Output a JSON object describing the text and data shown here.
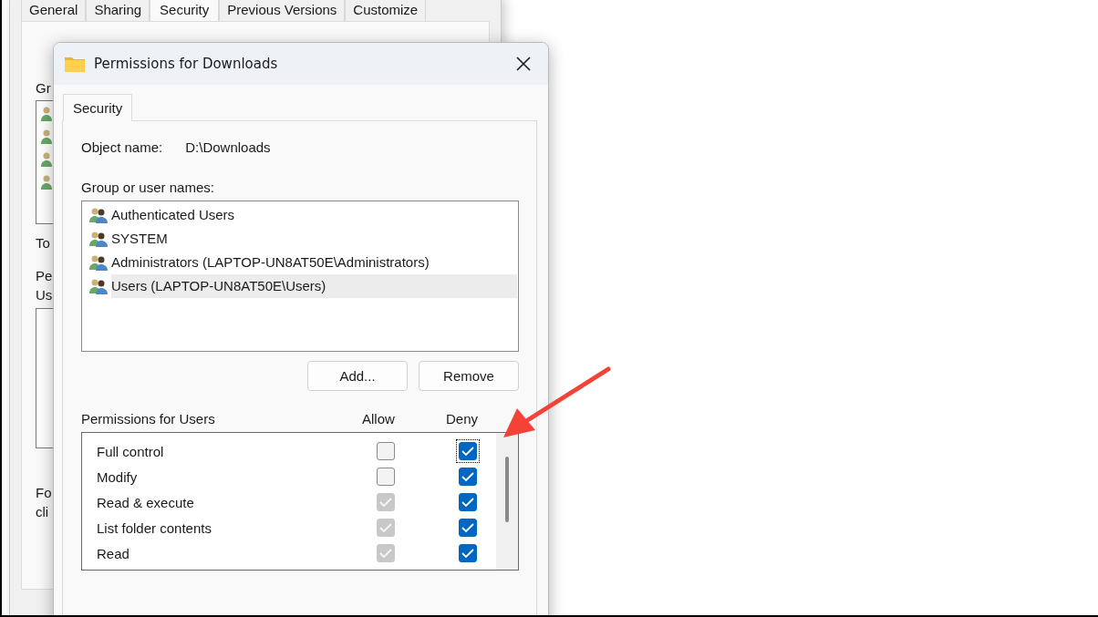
{
  "background_window": {
    "tabs": [
      {
        "label": "General",
        "selected": false
      },
      {
        "label": "Sharing",
        "selected": false
      },
      {
        "label": "Security",
        "selected": true
      },
      {
        "label": "Previous Versions",
        "selected": false
      },
      {
        "label": "Customize",
        "selected": false
      }
    ],
    "cut_labels": [
      "Gr",
      "To",
      "Pe",
      "Us",
      "Fo",
      "cli"
    ]
  },
  "dialog": {
    "title": "Permissions for Downloads",
    "tabs": [
      {
        "label": "Security",
        "selected": true
      }
    ],
    "object_name_label": "Object name:",
    "object_name": "D:\\Downloads",
    "group_label": "Group or user names:",
    "users": [
      {
        "name": "Authenticated Users",
        "selected": false
      },
      {
        "name": "SYSTEM",
        "selected": false
      },
      {
        "name": "Administrators (LAPTOP-UN8AT50E\\Administrators)",
        "selected": false
      },
      {
        "name": "Users (LAPTOP-UN8AT50E\\Users)",
        "selected": true
      }
    ],
    "buttons": [
      "Add...",
      "Remove"
    ],
    "permissions_label": "Permissions for Users",
    "allow_label": "Allow",
    "deny_label": "Deny",
    "permissions": [
      {
        "name": "Full control",
        "allow": false,
        "allow_disabled": false,
        "deny": true,
        "focused": true
      },
      {
        "name": "Modify",
        "allow": false,
        "allow_disabled": false,
        "deny": true,
        "focused": false
      },
      {
        "name": "Read & execute",
        "allow": true,
        "allow_disabled": true,
        "deny": true,
        "focused": false
      },
      {
        "name": "List folder contents",
        "allow": true,
        "allow_disabled": true,
        "deny": true,
        "focused": false
      },
      {
        "name": "Read",
        "allow": true,
        "allow_disabled": true,
        "deny": true,
        "focused": false
      }
    ]
  }
}
